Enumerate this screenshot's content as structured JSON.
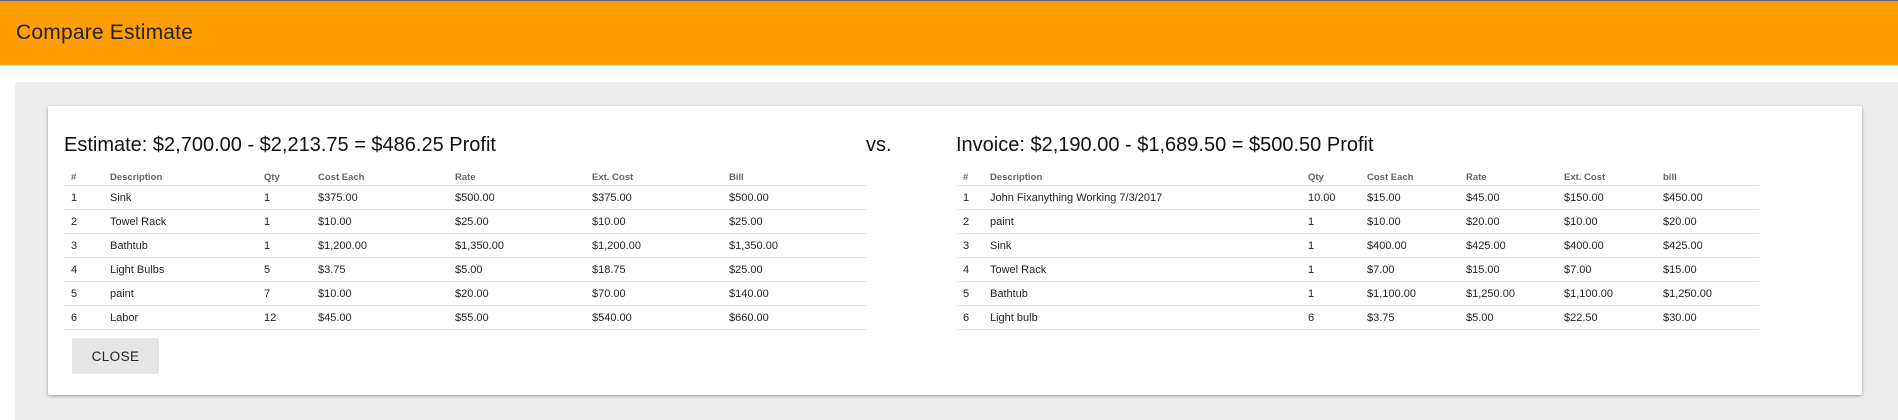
{
  "appbar": {
    "title": "Compare Estimate"
  },
  "estimate": {
    "heading": "Estimate: $2,700.00 - $2,213.75 = $486.25 Profit",
    "columns": [
      "#",
      "Description",
      "Qty",
      "Cost Each",
      "Rate",
      "Ext. Cost",
      "Bill"
    ],
    "rows": [
      [
        "1",
        "Sink",
        "1",
        "$375.00",
        "$500.00",
        "$375.00",
        "$500.00"
      ],
      [
        "2",
        "Towel Rack",
        "1",
        "$10.00",
        "$25.00",
        "$10.00",
        "$25.00"
      ],
      [
        "3",
        "Bathtub",
        "1",
        "$1,200.00",
        "$1,350.00",
        "$1,200.00",
        "$1,350.00"
      ],
      [
        "4",
        "Light Bulbs",
        "5",
        "$3.75",
        "$5.00",
        "$18.75",
        "$25.00"
      ],
      [
        "5",
        "paint",
        "7",
        "$10.00",
        "$20.00",
        "$70.00",
        "$140.00"
      ],
      [
        "6",
        "Labor",
        "12",
        "$45.00",
        "$55.00",
        "$540.00",
        "$660.00"
      ]
    ]
  },
  "vs_label": "vs.",
  "invoice": {
    "heading": "Invoice: $2,190.00 - $1,689.50 = $500.50 Profit",
    "columns": [
      "#",
      "Description",
      "Qty",
      "Cost Each",
      "Rate",
      "Ext. Cost",
      "bill"
    ],
    "rows": [
      [
        "1",
        "John Fixanything Working 7/3/2017",
        "10.00",
        "$15.00",
        "$45.00",
        "$150.00",
        "$450.00"
      ],
      [
        "2",
        "paint",
        "1",
        "$10.00",
        "$20.00",
        "$10.00",
        "$20.00"
      ],
      [
        "3",
        "Sink",
        "1",
        "$400.00",
        "$425.00",
        "$400.00",
        "$425.00"
      ],
      [
        "4",
        "Towel Rack",
        "1",
        "$7.00",
        "$15.00",
        "$7.00",
        "$15.00"
      ],
      [
        "5",
        "Bathtub",
        "1",
        "$1,100.00",
        "$1,250.00",
        "$1,100.00",
        "$1,250.00"
      ],
      [
        "6",
        "Light bulb",
        "6",
        "$3.75",
        "$5.00",
        "$22.50",
        "$30.00"
      ]
    ]
  },
  "close_label": "CLOSE",
  "colors": {
    "appbar": "#ff9e00",
    "background": "#ececec",
    "card": "#ffffff"
  }
}
